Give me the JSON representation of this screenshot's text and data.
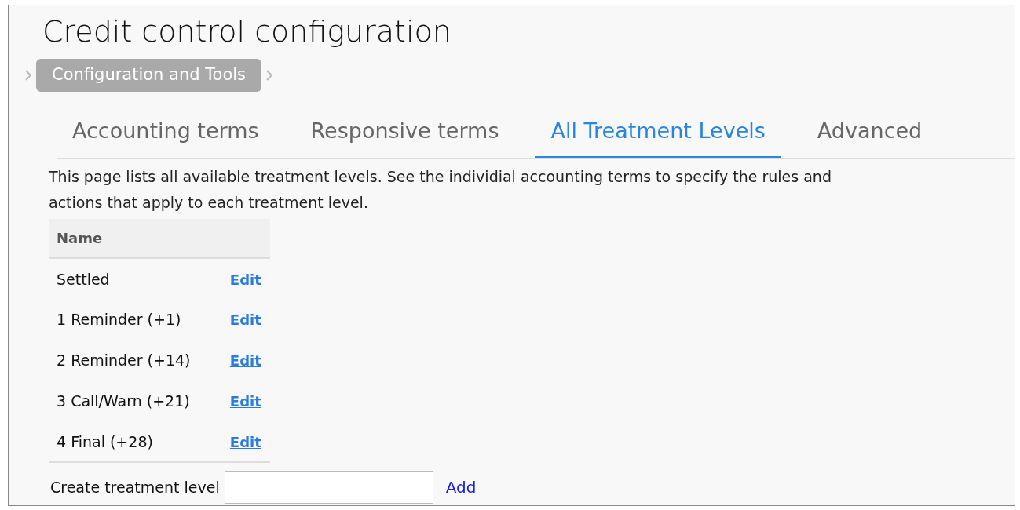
{
  "title": "Credit control configuration",
  "breadcrumb": {
    "label": "Configuration and Tools"
  },
  "tabs": [
    {
      "label": "Accounting terms",
      "selected": false
    },
    {
      "label": "Responsive terms",
      "selected": false
    },
    {
      "label": "All Treatment Levels",
      "selected": true
    },
    {
      "label": "Advanced",
      "selected": false
    }
  ],
  "description": "This page lists all available treatment levels. See the individial accounting terms to specify the rules and actions that apply to each treatment level.",
  "table": {
    "columns": [
      "Name"
    ],
    "rows": [
      {
        "name": "Settled",
        "action": "Edit"
      },
      {
        "name": "1 Reminder (+1)",
        "action": "Edit"
      },
      {
        "name": "2 Reminder (+14)",
        "action": "Edit"
      },
      {
        "name": "3 Call/Warn (+21)",
        "action": "Edit"
      },
      {
        "name": "4 Final (+28)",
        "action": "Edit"
      }
    ]
  },
  "create": {
    "label": "Create treatment level",
    "button": "Add"
  }
}
